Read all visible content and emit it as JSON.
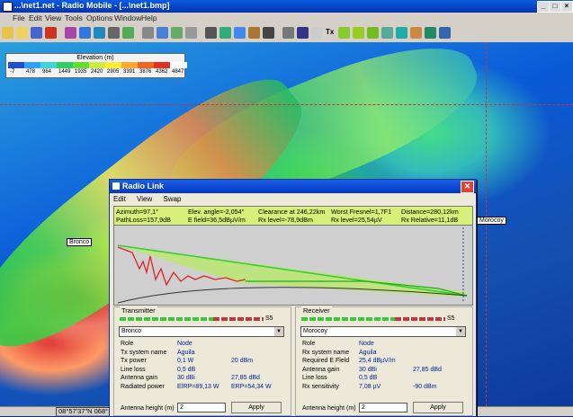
{
  "app": {
    "title": "...\\net1.net - Radio Mobile - [...\\net1.bmp]"
  },
  "menu": [
    "File",
    "Edit",
    "View",
    "Tools",
    "Options",
    "Window",
    "Help"
  ],
  "toolbar": {
    "icons": [
      "new-icon",
      "open-icon",
      "save-icon",
      "net-icon",
      "antenna-icon",
      "globe-icon",
      "globe2-icon",
      "satellite-icon",
      "merge-icon",
      "clear-icon",
      "copy-icon",
      "paste-icon",
      "page-icon",
      "print-icon",
      "export-icon",
      "picture-icon",
      "elevation-icon",
      "zoom-icon",
      "grid-icon",
      "find-icon",
      "text-icon",
      "link-icon",
      "polar-icon",
      "style-icon",
      "coverage-icon",
      "route-icon",
      "visual-icon",
      "map-icon",
      "info-icon"
    ],
    "text_button": "Tx"
  },
  "legend": {
    "title": "Elevation (m)",
    "ticks": [
      "-7",
      "478",
      "964",
      "1449",
      "1935",
      "2420",
      "2905",
      "3391",
      "3876",
      "4362",
      "4847"
    ],
    "colors": [
      "#2050d0",
      "#2fa0ff",
      "#3fd4d8",
      "#33cc66",
      "#66dd33",
      "#ccee44",
      "#ffee33",
      "#ffaa33",
      "#ee6622",
      "#dd3322",
      "#ffffff"
    ]
  },
  "map": {
    "sites": {
      "left": "Bronco",
      "right": "Morocoy"
    }
  },
  "status": {
    "coords": "08°57'37\"N  068°1"
  },
  "dialog": {
    "title": "Radio Link",
    "menu": [
      "Edit",
      "View",
      "Swap"
    ],
    "info": {
      "azimuth": "Azimuth=97,1°",
      "elev_angle": "Elev. angle=-2,054°",
      "clearance": "Clearance at 246,22km",
      "worst_fresnel": "Worst Fresnel=1,7F1",
      "distance": "Distance=280,12km",
      "pathloss": "PathLoss=157,9dB",
      "efield": "E field=36,5dBµV/m",
      "rx_level_dbm": "Rx level=-78,9dBm",
      "rx_level_uv": "Rx level=25,54µV",
      "rx_relative": "Rx Relative=11,1dB"
    },
    "transmitter": {
      "label": "Transmitter",
      "scale": "S5",
      "selected": "Bronco",
      "rows": [
        {
          "label": "Role",
          "v1": "Node",
          "v2": ""
        },
        {
          "label": "Tx system name",
          "v1": "Aguila",
          "v2": ""
        },
        {
          "label": "Tx power",
          "v1": "0,1 W",
          "v2": "20 dBm"
        },
        {
          "label": "Line loss",
          "v1": "0,5 dB",
          "v2": ""
        },
        {
          "label": "Antenna gain",
          "v1": "30 dBi",
          "v2": "27,85 dBd"
        },
        {
          "label": "Radiated power",
          "v1": "EIRP=89,13 W",
          "v2": "ERP=54,34 W"
        }
      ],
      "antenna_label": "Antenna height (m)",
      "antenna_value": "2",
      "apply": "Apply"
    },
    "receiver": {
      "label": "Receiver",
      "scale": "S5",
      "selected": "Morocoy",
      "rows": [
        {
          "label": "Role",
          "v1": "Node",
          "v2": ""
        },
        {
          "label": "Rx system name",
          "v1": "Aguila",
          "v2": ""
        },
        {
          "label": "Required E Field",
          "v1": "25,4 dBµV/m",
          "v2": ""
        },
        {
          "label": "Antenna gain",
          "v1": "30 dBi",
          "v2": "27,85 dBd"
        },
        {
          "label": "Line loss",
          "v1": "0,5 dB",
          "v2": ""
        },
        {
          "label": "Rx sensitivity",
          "v1": "7,08 µV",
          "v2": "-90 dBm"
        }
      ],
      "antenna_label": "Antenna height (m)",
      "antenna_value": "2",
      "apply": "Apply"
    }
  }
}
